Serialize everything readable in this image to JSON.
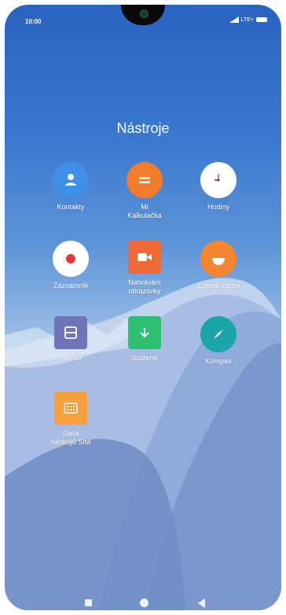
{
  "status_bar": {
    "time": "10:00",
    "network": "LTE+"
  },
  "folder": {
    "title": "Nástroje"
  },
  "apps": [
    {
      "label": "Kontakty",
      "icon": "person-icon",
      "color": "#3d8fe8"
    },
    {
      "label": "Mi\nKalkulačka",
      "icon": "calculator-icon",
      "color": "#f37c2c"
    },
    {
      "label": "Hodiny",
      "icon": "clock-icon",
      "color": "#ffffff"
    },
    {
      "label": "Záznamník",
      "icon": "record-icon",
      "color": "#ffffff"
    },
    {
      "label": "Nahrávání\nobrazovky",
      "icon": "video-camera-icon",
      "color": "#ef6a35"
    },
    {
      "label": "Zpětná vazba",
      "icon": "feedback-icon",
      "color": "#f5862f"
    },
    {
      "label": "Skener",
      "icon": "scanner-icon",
      "color": "#6f74b8"
    },
    {
      "label": "Stažené",
      "icon": "download-icon",
      "color": "#2fbf71"
    },
    {
      "label": "Kompas",
      "icon": "compass-icon",
      "color": "#1aa6a9"
    },
    {
      "label": "Sada\nnástrojů SIM",
      "icon": "sim-toolkit-icon",
      "color": "#f5a03c"
    }
  ],
  "nav": {
    "recents": "recents-square-icon",
    "home": "home-circle-icon",
    "back": "back-triangle-icon"
  }
}
